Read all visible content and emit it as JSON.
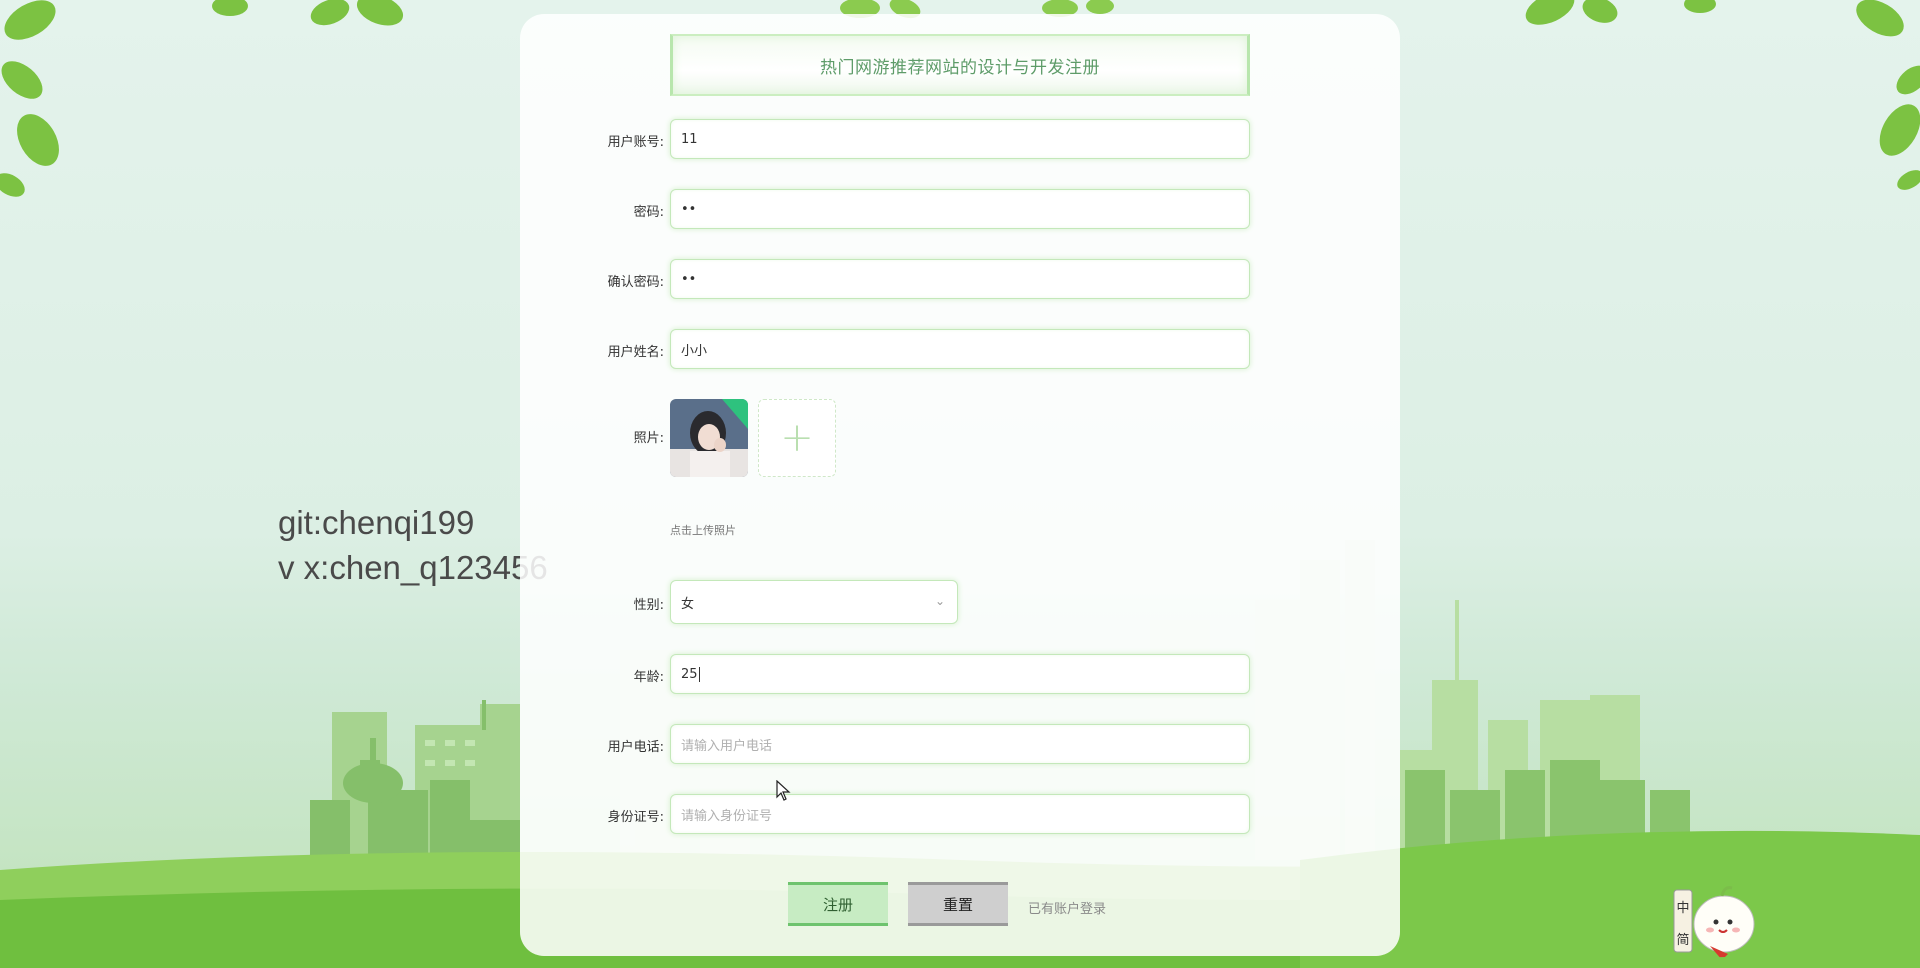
{
  "watermark": {
    "line1": "git:chenqi199",
    "line2": "v x:chen_q123456"
  },
  "form": {
    "title": "热门网游推荐网站的设计与开发注册",
    "fields": {
      "account": {
        "label": "用户账号:",
        "value": "11"
      },
      "password": {
        "label": "密码:",
        "value": "••"
      },
      "confirm_password": {
        "label": "确认密码:",
        "value": "••"
      },
      "name": {
        "label": "用户姓名:",
        "value": "小小"
      },
      "photo": {
        "label": "照片:",
        "hint": "点击上传照片",
        "upload_symbol": "+"
      },
      "gender": {
        "label": "性别:",
        "value": "女"
      },
      "age": {
        "label": "年龄:",
        "value": "25"
      },
      "phone": {
        "label": "用户电话:",
        "placeholder": "请输入用户电话"
      },
      "id_number": {
        "label": "身份证号:",
        "placeholder": "请输入身份证号"
      }
    },
    "buttons": {
      "register": "注册",
      "reset": "重置",
      "login_link": "已有账户登录"
    }
  },
  "mascot": {
    "sign_text": "中简"
  },
  "colors": {
    "accent_green": "#6ec36e",
    "title_green": "#5e9c69",
    "input_border": "#c4e8ba"
  }
}
